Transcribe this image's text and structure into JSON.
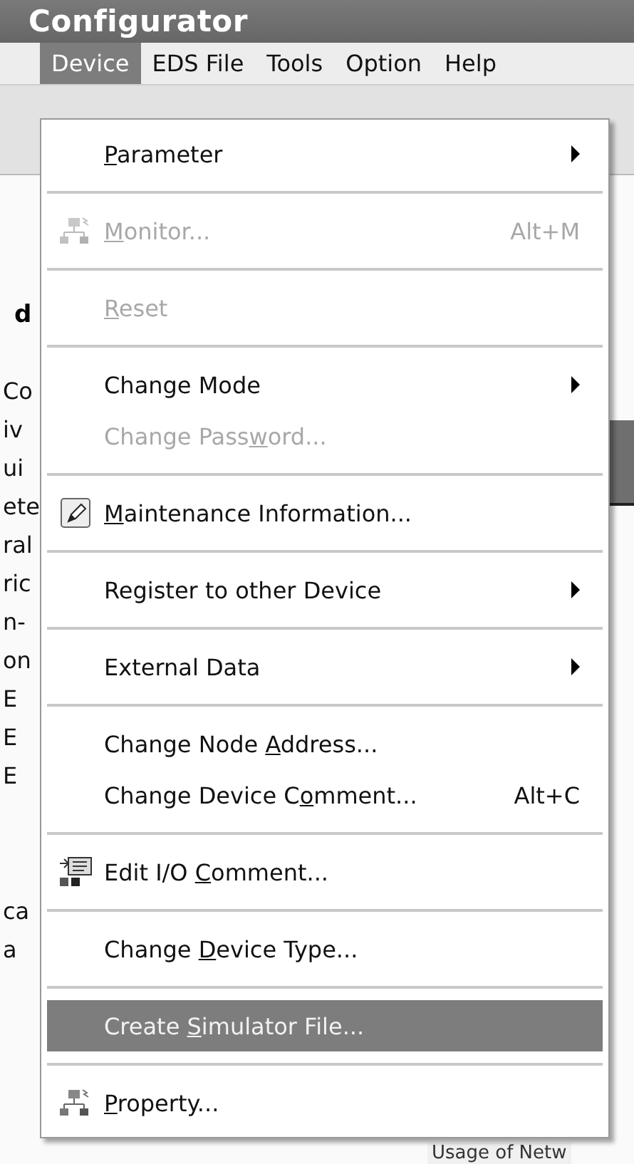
{
  "window": {
    "title": "Configurator"
  },
  "menu_bar": [
    {
      "label": "Device",
      "selected": true
    },
    {
      "label": "EDS File",
      "selected": false
    },
    {
      "label": "Tools",
      "selected": false
    },
    {
      "label": "Option",
      "selected": false
    },
    {
      "label": "Help",
      "selected": false
    }
  ],
  "left_panel": {
    "heading": "d",
    "lines": [
      "Co",
      "iv",
      "ui",
      "ete",
      "ral",
      "ric",
      "n-",
      "on",
      "E",
      "E",
      "E"
    ],
    "lower_lines": [
      "ca",
      "a"
    ]
  },
  "right_panel": {
    "label": "Usage of Netw"
  },
  "menu": [
    {
      "kind": "item",
      "key": "P",
      "post": "arameter",
      "submenu": true,
      "disabled": false,
      "selected": false
    },
    {
      "kind": "separator"
    },
    {
      "kind": "item",
      "key": "M",
      "post": "onitor...",
      "shortcut": "Alt+M",
      "submenu": false,
      "disabled": true,
      "selected": false
    },
    {
      "kind": "separator"
    },
    {
      "kind": "item",
      "key": "R",
      "post": "eset",
      "submenu": false,
      "disabled": true,
      "selected": false
    },
    {
      "kind": "separator"
    },
    {
      "kind": "item",
      "pre": "Change Mode",
      "submenu": true,
      "disabled": false,
      "selected": false
    },
    {
      "kind": "item",
      "pre": "Change Pass",
      "key": "w",
      "post": "ord...",
      "submenu": false,
      "disabled": true,
      "selected": false
    },
    {
      "kind": "separator"
    },
    {
      "kind": "item",
      "key": "M",
      "post": "aintenance Information...",
      "submenu": false,
      "disabled": false,
      "selected": false
    },
    {
      "kind": "separator"
    },
    {
      "kind": "item",
      "pre": "Register to other Device",
      "submenu": true,
      "disabled": false,
      "selected": false
    },
    {
      "kind": "separator"
    },
    {
      "kind": "item",
      "pre": "External Data",
      "submenu": true,
      "disabled": false,
      "selected": false
    },
    {
      "kind": "separator"
    },
    {
      "kind": "item",
      "pre": "Change Node ",
      "key": "A",
      "post": "ddress...",
      "submenu": false,
      "disabled": false,
      "selected": false
    },
    {
      "kind": "item",
      "pre": "Change Device C",
      "key": "o",
      "post": "mment...",
      "shortcut": "Alt+C",
      "submenu": false,
      "disabled": false,
      "selected": false
    },
    {
      "kind": "separator"
    },
    {
      "kind": "item",
      "pre": "Edit I/O ",
      "key": "C",
      "post": "omment...",
      "submenu": false,
      "disabled": false,
      "selected": false
    },
    {
      "kind": "separator"
    },
    {
      "kind": "item",
      "pre": "Change ",
      "key": "D",
      "post": "evice Type...",
      "submenu": false,
      "disabled": false,
      "selected": false
    },
    {
      "kind": "separator"
    },
    {
      "kind": "item",
      "pre": "Create ",
      "key": "S",
      "post": "imulator File...",
      "submenu": false,
      "disabled": false,
      "selected": true
    },
    {
      "kind": "separator"
    },
    {
      "kind": "item",
      "key": "P",
      "post": "roperty...",
      "submenu": false,
      "disabled": false,
      "selected": false
    }
  ]
}
